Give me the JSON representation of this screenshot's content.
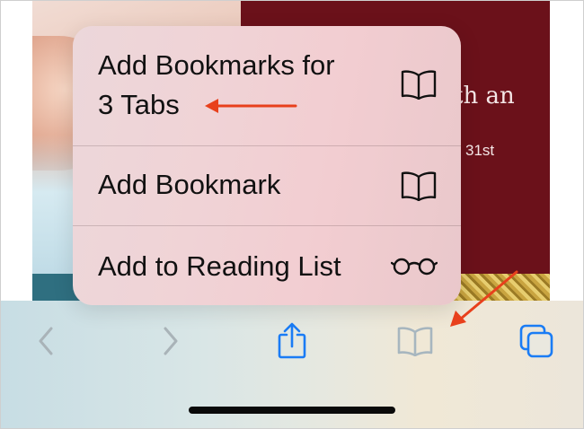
{
  "background_page": {
    "card_text_line1": "th an",
    "card_text_line2": "31st"
  },
  "menu": {
    "items": [
      {
        "label_line1": "Add Bookmarks for",
        "label_line2": "3 Tabs",
        "icon": "book-icon"
      },
      {
        "label": "Add Bookmark",
        "icon": "book-icon"
      },
      {
        "label": "Add to Reading List",
        "icon": "glasses-icon"
      }
    ]
  },
  "toolbar": {
    "buttons": [
      {
        "icon": "back-chevron-icon",
        "enabled": false
      },
      {
        "icon": "forward-chevron-icon",
        "enabled": false
      },
      {
        "icon": "share-icon",
        "enabled": true
      },
      {
        "icon": "bookmarks-icon",
        "enabled": true
      },
      {
        "icon": "tabs-icon",
        "enabled": true
      }
    ]
  },
  "colors": {
    "accent": "#1a7cf5",
    "annotation_arrow": "#e8401c",
    "disabled_icon": "#a9b3b8",
    "bookmarks_icon_highlighted": "#a7b6bf"
  }
}
